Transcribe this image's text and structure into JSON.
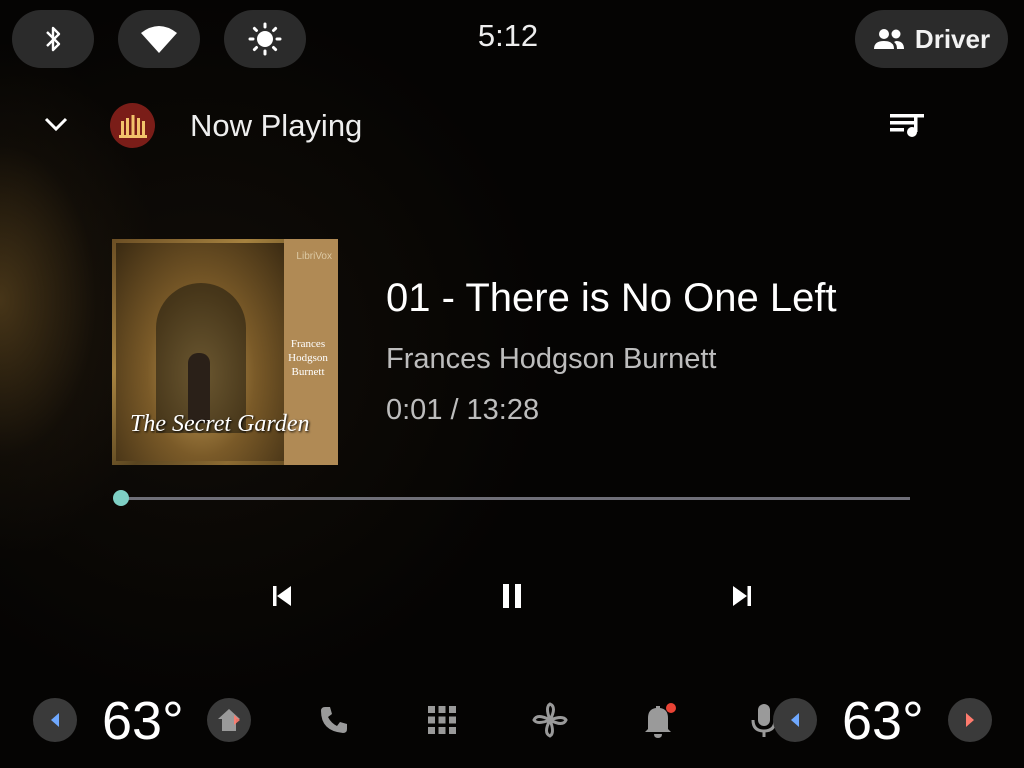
{
  "status_bar": {
    "clock": "5:12",
    "profile_label": "Driver",
    "icons": [
      "bluetooth-icon",
      "wifi-icon",
      "brightness-icon",
      "people-icon"
    ]
  },
  "header": {
    "title": "Now Playing",
    "app_icon": "audiobook-app-icon",
    "queue_icon": "queue-music-icon"
  },
  "album_art": {
    "brand": "LibriVox",
    "author": "Frances Hodgson Burnett",
    "title": "The Secret Garden"
  },
  "track": {
    "title": "01 - There is No One Left",
    "artist": "Frances Hodgson Burnett",
    "elapsed": "0:01",
    "separator": "/",
    "duration": "13:28",
    "progress_fraction": 0.0012
  },
  "controls": [
    "skip-previous-icon",
    "pause-icon",
    "skip-next-icon"
  ],
  "bottom_bar": {
    "left_temp": "63°",
    "right_temp": "63°",
    "dock": [
      "home-icon",
      "phone-icon",
      "apps-grid-icon",
      "fan-icon",
      "notification-bell-icon",
      "microphone-icon"
    ]
  },
  "colors": {
    "accent": "#7ecfc4",
    "left_arrow_accent": "#6fa8ff",
    "right_arrow_accent": "#ff7b6e",
    "notification_dot": "#ea4335"
  }
}
